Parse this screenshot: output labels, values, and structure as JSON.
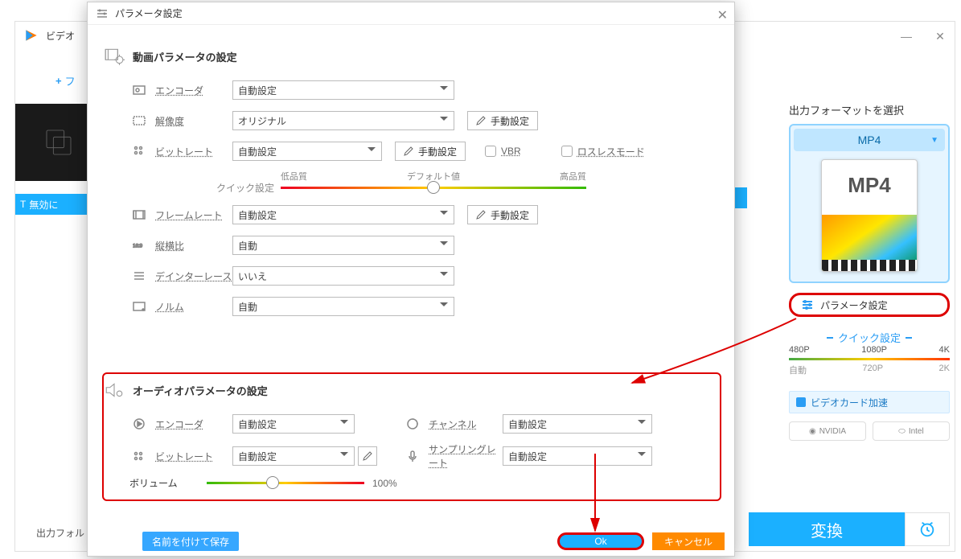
{
  "main": {
    "title": "ビデオ",
    "add_label": "フ",
    "invalid_tag": "無効に",
    "output_folder_label": "出力フォル"
  },
  "right": {
    "title": "出力フォーマットを選択",
    "format_name": "MP4",
    "thumb_label": "MP4",
    "param_btn": "パラメータ設定",
    "quick_title": "クイック設定",
    "scale": {
      "p480": "480P",
      "p1080": "1080P",
      "p4k": "4K",
      "auto": "自動",
      "p720": "720P",
      "p2k": "2K"
    },
    "accel": "ビデオカード加速",
    "nvidia": "NVIDIA",
    "intel": "Intel",
    "convert": "変換"
  },
  "dialog": {
    "title": "パラメータ設定",
    "video_section": "動画パラメータの設定",
    "audio_section": "オーディオパラメータの設定",
    "labels": {
      "encoder": "エンコーダ",
      "resolution": "解像度",
      "bitrate": "ビットレート",
      "quick": "クイック設定",
      "low": "低品質",
      "default": "デフォルト値",
      "high": "高品質",
      "framerate": "フレームレート",
      "aspect": "縦横比",
      "deinterlace": "デインターレース",
      "norm": "ノルム",
      "channel": "チャンネル",
      "sampling": "サンプリングレート",
      "volume": "ボリューム",
      "manual": "手動設定",
      "vbr": "VBR",
      "lossless": "ロスレスモード"
    },
    "values": {
      "auto": "自動設定",
      "original": "オリジナル",
      "auto2": "自動",
      "no": "いいえ",
      "vol_pct": "100%"
    },
    "footer": {
      "save_as": "名前を付けて保存",
      "ok": "Ok",
      "cancel": "キャンセル"
    }
  }
}
